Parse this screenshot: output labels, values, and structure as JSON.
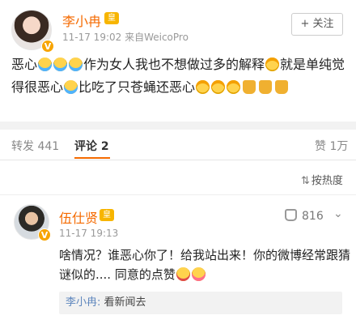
{
  "post": {
    "username": "李小冉",
    "crown_badge": "皇",
    "verified_badge": "V",
    "meta": "11-17 19:02  来自WeicoPro",
    "follow_label": "+ 关注",
    "text_segments": [
      "恶心",
      "作为女人我也不想做过多的解释",
      "就是单纯觉得很恶心",
      "比吃了只苍蝇还恶心"
    ]
  },
  "tabs": {
    "repost": "转发 441",
    "comment": "评论 2",
    "like": "赞 1万"
  },
  "sort": {
    "icon": "⇅",
    "label": "按热度"
  },
  "comment": {
    "username": "伍仕贤",
    "crown_badge": "皇",
    "verified_badge": "V",
    "meta": "11-17 19:13",
    "like_count": "816",
    "more_icon": "⌄",
    "text_main": "啥情况？谁恶心你了！给我站出来！你的微博经常跟猜谜似的.... 同意的点赞",
    "reply_author": "李小冉:",
    "reply_text": " 看新闻去"
  },
  "icons": {
    "emoji_cry": "emoji-cry-icon",
    "emoji_cover": "emoji-cover-face-icon",
    "thumb_down": "thumb-down-icon",
    "thumb_up": "thumb-up-outline-icon"
  },
  "colors": {
    "username": "#f56a00",
    "reply_author": "#5e86bd",
    "active_tab_underline": "#f56a00"
  }
}
